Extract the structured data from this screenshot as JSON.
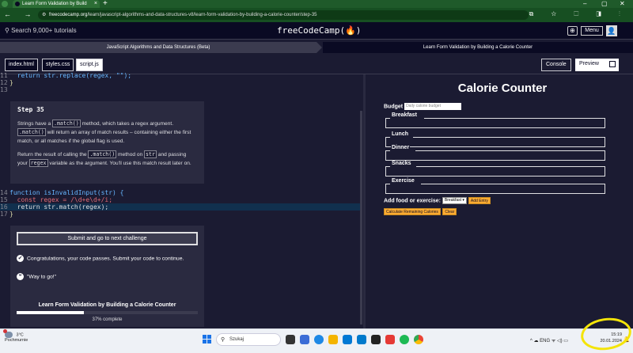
{
  "browser": {
    "tab_title": "Learn Form Validation by Build",
    "tab_close": "×",
    "new_tab": "+",
    "window_controls": [
      "–",
      "▢",
      "✕"
    ],
    "nav_icons": "← → ↻",
    "url_domain": "freecodecamp.org",
    "url_path": "/learn/javascript-algorithms-and-data-structures-v8/learn-form-validation-by-building-a-calorie-counter/step-35",
    "toolbar_icons": "⧉ ☆ ⬚ ◨ ⋮"
  },
  "fcc": {
    "search_placeholder": "Search 9,000+ tutorials",
    "logo": "freeCodeCamp(🔥)",
    "menu_label": "Menu",
    "globe": "⊕"
  },
  "breadcrumb": {
    "superblock": "JavaScript Algorithms and Data Structures (Beta)",
    "block": "Learn Form Validation by Building a Calorie Counter"
  },
  "files": {
    "tabs": [
      "index.html",
      "styles.css",
      "script.js"
    ],
    "active": "script.js",
    "console_label": "Console",
    "preview_label": "Preview"
  },
  "editor": {
    "top_lines": [
      {
        "n": "11",
        "text": "  return str.replace(regex, \"\");"
      },
      {
        "n": "12",
        "text": "}"
      },
      {
        "n": "13",
        "text": ""
      }
    ],
    "bottom_lines": [
      {
        "n": "14",
        "text": "function isInvalidInput(str) {"
      },
      {
        "n": "15",
        "text": "  const regex = /\\d+e\\d+/i;"
      },
      {
        "n": "16",
        "text": "  return str.match(regex);"
      },
      {
        "n": "17",
        "text": "}"
      }
    ]
  },
  "step": {
    "title": "Step 35",
    "p1_a": "Strings have a ",
    "p1_code1": ".match()",
    "p1_b": " method, which takes a regex argument. ",
    "p1_code2": ".match()",
    "p1_c": " will return an array of match results – containing either the first match, or all matches if the global flag is used.",
    "p2_a": "Return the result of calling the ",
    "p2_code1": ".match()",
    "p2_b": " method on ",
    "p2_code2": "str",
    "p2_c": " and passing your ",
    "p2_code3": "regex",
    "p2_d": " variable as the argument. You'll use this match result later on."
  },
  "result": {
    "submit_label": "Submit and go to next challenge",
    "congrats": "Congratulations, your code passes. Submit your code to continue.",
    "quote": "\"Way to go!\"",
    "progress_title": "Learn Form Validation by Building a Calorie Counter",
    "progress_percent": 37,
    "progress_text": "37% complete"
  },
  "preview": {
    "title": "Calorie Counter",
    "budget_label": "Budget",
    "budget_placeholder": "Daily calorie budget",
    "fieldsets": [
      "Breakfast",
      "Lunch",
      "Dinner",
      "Snacks",
      "Exercise"
    ],
    "add_label": "Add food or exercise:",
    "select_value": "Breakfast ▾",
    "add_entry": "Add Entry",
    "calculate": "Calculate Remaining Calories",
    "clear": "Clear"
  },
  "taskbar": {
    "temp": "3°C",
    "condition": "Pochmurnie",
    "search_placeholder": "Szukaj",
    "tray_text": "^ ☁ ENG ᯤ ◁) ▭",
    "time": "15:19",
    "date": "20.01.2024",
    "bell": "🔔"
  },
  "colors": {
    "fcc_bg": "#0a0a23",
    "panel": "#2a2a40",
    "accent_yellow": "#feac32",
    "annotation_circle": "#f4e409"
  }
}
